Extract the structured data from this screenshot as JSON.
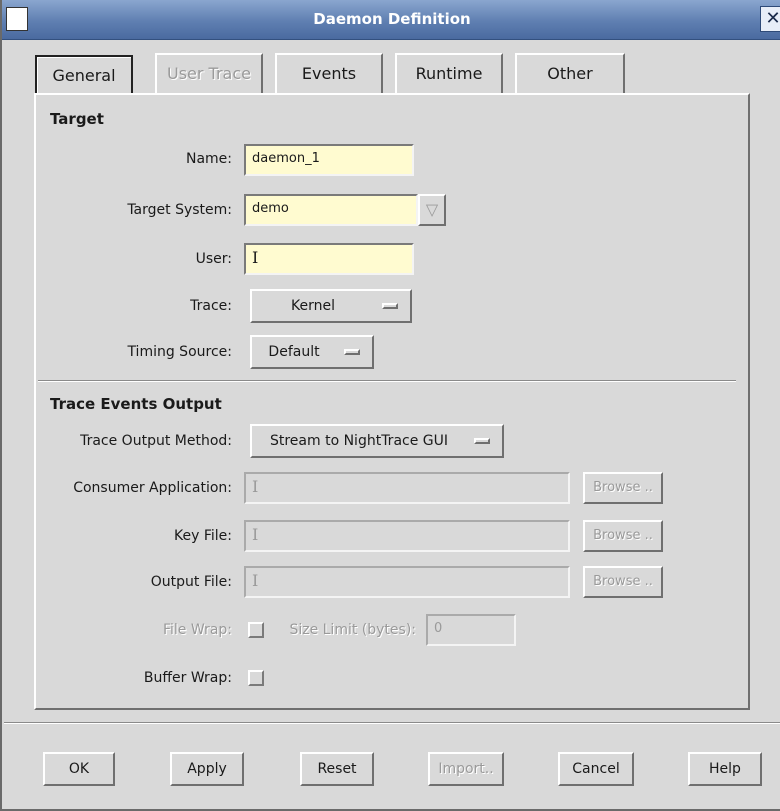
{
  "window": {
    "title": "Daemon Definition",
    "close_glyph": "✕"
  },
  "tabs": [
    {
      "label": "General",
      "selected": true,
      "enabled": true
    },
    {
      "label": "User Trace",
      "selected": false,
      "enabled": false
    },
    {
      "label": "Events",
      "selected": false,
      "enabled": true
    },
    {
      "label": "Runtime",
      "selected": false,
      "enabled": true
    },
    {
      "label": "Other",
      "selected": false,
      "enabled": true
    }
  ],
  "target": {
    "section_title": "Target",
    "name_label": "Name:",
    "name_value": "daemon_1",
    "target_system_label": "Target System:",
    "target_system_value": "demo",
    "target_system_dropdown_glyph": "▽",
    "user_label": "User:",
    "user_value": "I",
    "trace_label": "Trace:",
    "trace_value": "Kernel",
    "timing_source_label": "Timing Source:",
    "timing_source_value": "Default"
  },
  "trace_output": {
    "section_title": "Trace Events Output",
    "method_label": "Trace Output Method:",
    "method_value": "Stream to NightTrace GUI",
    "consumer_label": "Consumer Application:",
    "consumer_value": "I",
    "key_file_label": "Key File:",
    "key_file_value": "I",
    "output_file_label": "Output File:",
    "output_file_value": "I",
    "browse_label": "Browse ..",
    "file_wrap_label": "File Wrap:",
    "file_wrap_checked": false,
    "size_limit_label": "Size Limit (bytes):",
    "size_limit_value": "0",
    "buffer_wrap_label": "Buffer Wrap:",
    "buffer_wrap_checked": false
  },
  "buttons": {
    "ok": "OK",
    "apply": "Apply",
    "reset": "Reset",
    "import": "Import..",
    "cancel": "Cancel",
    "help": "Help"
  },
  "colors": {
    "titlebar": "#5f7fb1",
    "field_bg": "#fffbd0",
    "window_bg": "#d9d9d9"
  }
}
